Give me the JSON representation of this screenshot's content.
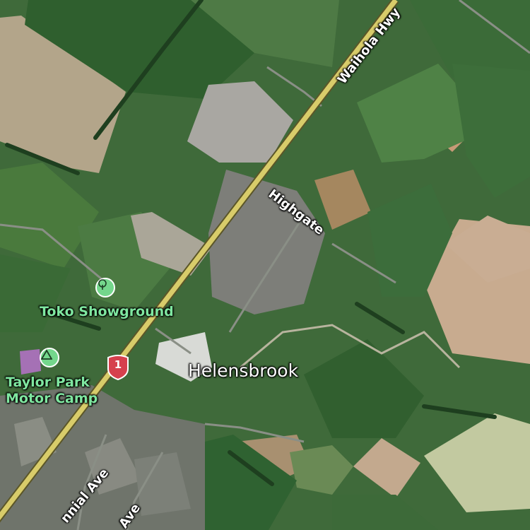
{
  "map": {
    "places": {
      "town": "Helensbrook"
    },
    "pois": [
      {
        "key": "showground",
        "label": "Toko Showground",
        "icon": "tree-icon"
      },
      {
        "key": "camp",
        "label_lines": [
          "Taylor Park",
          "Motor Camp"
        ],
        "icon": "campsite-icon"
      }
    ],
    "roads": {
      "highway": "Waihola Hwy",
      "highgate": "Highgate",
      "centennial": "nnial Ave",
      "ave": "Ave"
    },
    "route_shield": {
      "number": "1",
      "color": "#d6404d"
    },
    "colors": {
      "highway": "#d8cc6a",
      "poi_green": "#74d78c",
      "field_green": "#3f6a3a"
    }
  }
}
